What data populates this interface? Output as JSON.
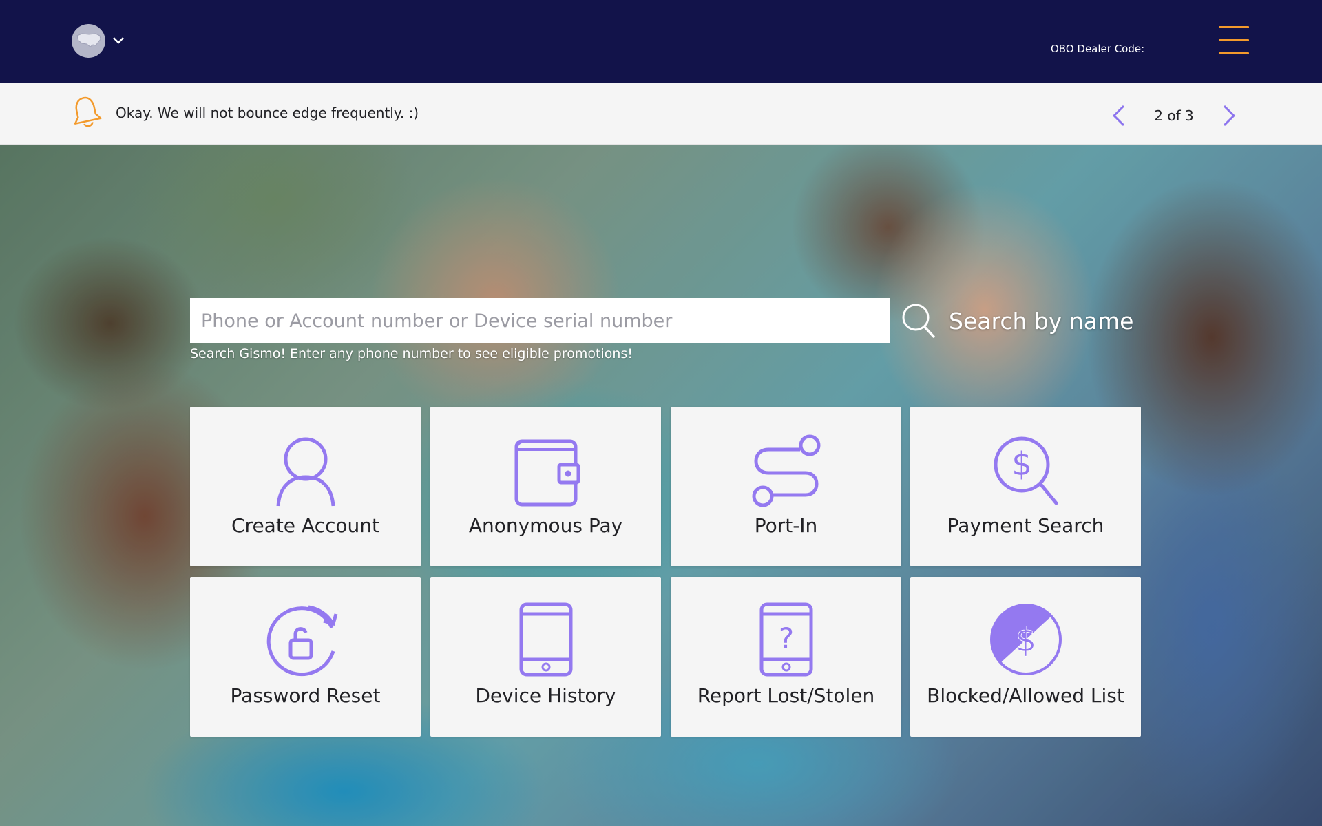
{
  "header": {
    "dealer_code_label": "OBO Dealer Code:",
    "country_icon": "us-map-globe-icon",
    "menu_icon": "hamburger-menu-icon",
    "bg_color": "#12134a",
    "accent_color": "#f39a2c"
  },
  "notice": {
    "message": "Okay. We will not bounce edge frequently. :)",
    "pager": "2 of 3",
    "bell_icon": "bell-icon"
  },
  "search": {
    "placeholder": "Phone or Account number or Device serial number",
    "help": "Search Gismo! Enter any phone number to see eligible promotions!",
    "by_name_label": "Search by name"
  },
  "tiles": [
    {
      "label": "Create Account",
      "icon": "user-icon"
    },
    {
      "label": "Anonymous Pay",
      "icon": "wallet-icon"
    },
    {
      "label": "Port-In",
      "icon": "route-icon"
    },
    {
      "label": "Payment Search",
      "icon": "dollar-search-icon"
    },
    {
      "label": "Password Reset",
      "icon": "unlock-reset-icon"
    },
    {
      "label": "Device History",
      "icon": "phone-icon"
    },
    {
      "label": "Report Lost/Stolen",
      "icon": "phone-question-icon"
    },
    {
      "label": "Blocked/Allowed List",
      "icon": "dollar-blocked-icon"
    }
  ],
  "colors": {
    "icon": "#9479f0",
    "tile_bg": "#f5f5f5"
  }
}
